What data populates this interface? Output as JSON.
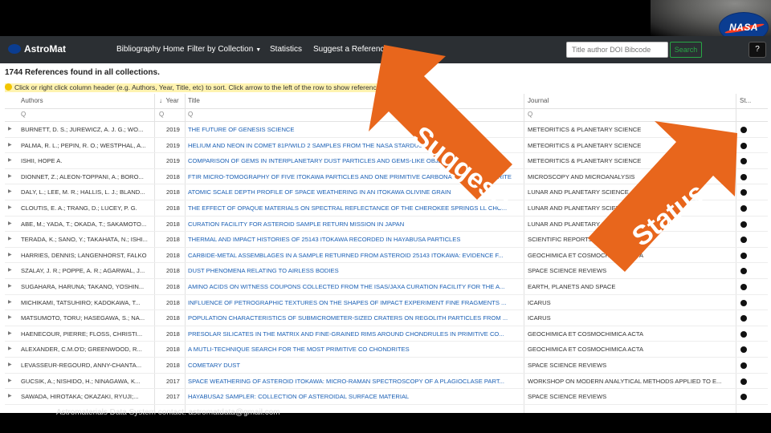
{
  "app": {
    "brand": "AstroMat",
    "nasa_logo_text": "NASA"
  },
  "navbar": {
    "items": [
      "Bibliography Home",
      "Filter by Collection",
      "Statistics",
      "Suggest a Reference"
    ],
    "search_placeholder": "Title author DOI Bibcode",
    "search_button": "Search",
    "help_icon": "?"
  },
  "page": {
    "count_title": "1744 References found in all collections.",
    "hint": "Click or right click column header (e.g. Authors, Year, Title, etc) to sort. Click arrow to the left of the row to show reference details"
  },
  "table": {
    "columns": {
      "authors": "Authors",
      "year": "Year",
      "title": "Title",
      "journal": "Journal",
      "status": "St..."
    },
    "sort_indicator": "↓",
    "filter_placeholder": "Q",
    "rows": [
      {
        "authors": "BURNETT, D. S.; JUREWICZ, A. J. G.; WO...",
        "year": "2019",
        "title": "THE FUTURE OF GENESIS SCIENCE",
        "journal": "METEORITICS & PLANETARY SCIENCE"
      },
      {
        "authors": "PALMA, R. L.; PEPIN, R. O.; WESTPHAL, A...",
        "year": "2019",
        "title": "HELIUM AND NEON IN COMET 81P/WILD 2 SAMPLES FROM THE NASA STARDUST MISSION",
        "journal": "METEORITICS & PLANETARY SCIENCE"
      },
      {
        "authors": "ISHII, HOPE A.",
        "year": "2019",
        "title": "COMPARISON OF GEMS IN INTERPLANETARY DUST PARTICLES AND GEMS-LIKE OBJECTS IN A STARDUST",
        "journal": "METEORITICS & PLANETARY SCIENCE"
      },
      {
        "authors": "DIONNET, Z.; ALEON-TOPPANI, A.; BORO...",
        "year": "2018",
        "title": "FTIR MICRO-TOMOGRAPHY OF FIVE ITOKAWA PARTICLES AND ONE PRIMITIVE CARBONACEOUS CHONDRITE",
        "journal": "MICROSCOPY AND MICROANALYSIS"
      },
      {
        "authors": "DALY, L.; LEE, M. R.; HALLIS, L. J.; BLAND...",
        "year": "2018",
        "title": "ATOMIC SCALE DEPTH PROFILE OF SPACE WEATHERING IN AN ITOKAWA OLIVINE GRAIN",
        "journal": "LUNAR AND PLANETARY SCIENCE"
      },
      {
        "authors": "CLOUTIS, E. A.; TRANG, D.; LUCEY, P. G.",
        "year": "2018",
        "title": "THE EFFECT OF OPAQUE MATERIALS ON SPECTRAL REFLECTANCE OF THE CHEROKEE SPRINGS LL CHO...",
        "journal": "LUNAR AND PLANETARY SCIENCE"
      },
      {
        "authors": "ABE, M.; YADA, T.; OKADA, T.; SAKAMOTO...",
        "year": "2018",
        "title": "CURATION FACILITY FOR ASTEROID SAMPLE RETURN MISSION IN JAPAN",
        "journal": "LUNAR AND PLANETARY SCIENCE"
      },
      {
        "authors": "TERADA, K.; SANO, Y.; TAKAHATA, N.; ISHI...",
        "year": "2018",
        "title": "THERMAL AND IMPACT HISTORIES OF 25143 ITOKAWA RECORDED IN HAYABUSA PARTICLES",
        "journal": "SCIENTIFIC REPORTS"
      },
      {
        "authors": "HARRIES, DENNIS; LANGENHORST, FALKO",
        "year": "2018",
        "title": "CARBIDE-METAL ASSEMBLAGES IN A SAMPLE RETURNED FROM ASTEROID 25143 ITOKAWA: EVIDENCE F...",
        "journal": "GEOCHIMICA ET COSMOCHIMICA ACTA"
      },
      {
        "authors": "SZALAY, J. R.; POPPE, A. R.; AGARWAL, J...",
        "year": "2018",
        "title": "DUST PHENOMENA RELATING TO AIRLESS BODIES",
        "journal": "SPACE SCIENCE REVIEWS"
      },
      {
        "authors": "SUGAHARA, HARUNA; TAKANO, YOSHIN...",
        "year": "2018",
        "title": "AMINO ACIDS ON WITNESS COUPONS COLLECTED FROM THE ISAS/JAXA CURATION FACILITY FOR THE A...",
        "journal": "EARTH, PLANETS AND SPACE"
      },
      {
        "authors": "MICHIKAMI, TATSUHIRO; KADOKAWA, T...",
        "year": "2018",
        "title": "INFLUENCE OF PETROGRAPHIC TEXTURES ON THE SHAPES OF IMPACT EXPERIMENT FINE FRAGMENTS ...",
        "journal": "ICARUS"
      },
      {
        "authors": "MATSUMOTO, TORU; HASEGAWA, S.; NA...",
        "year": "2018",
        "title": "POPULATION CHARACTERISTICS OF SUBMICROMETER-SIZED CRATERS ON REGOLITH PARTICLES FROM ...",
        "journal": "ICARUS"
      },
      {
        "authors": "HAENECOUR, PIERRE; FLOSS, CHRISTI...",
        "year": "2018",
        "title": "PRESOLAR SILICATES IN THE MATRIX AND FINE-GRAINED RIMS AROUND CHONDRULES IN PRIMITIVE CO...",
        "journal": "GEOCHIMICA ET COSMOCHIMICA ACTA"
      },
      {
        "authors": "ALEXANDER, C.M.O'D; GREENWOOD, R...",
        "year": "2018",
        "title": "A MUTLI-TECHNIQUE SEARCH FOR THE MOST PRIMITIVE CO CHONDRITES",
        "journal": "GEOCHIMICA ET COSMOCHIMICA ACTA"
      },
      {
        "authors": "LEVASSEUR-REGOURD, ANNY-CHANTA...",
        "year": "2018",
        "title": "COMETARY DUST",
        "journal": "SPACE SCIENCE REVIEWS"
      },
      {
        "authors": "GUCSIK, A.; NISHIDO, H.; NINAGAWA, K...",
        "year": "2017",
        "title": "SPACE WEATHERING OF ASTEROID ITOKAWA: MICRO-RAMAN SPECTROSCOPY OF A PLAGIOCLASE PART...",
        "journal": "WORKSHOP ON MODERN ANALYTICAL METHODS APPLIED TO E..."
      },
      {
        "authors": "SAWADA, HIROTAKA; OKAZAKI, RYUJI;...",
        "year": "2017",
        "title": "HAYABUSA2 SAMPLER: COLLECTION OF ASTEROIDAL SURFACE MATERIAL",
        "journal": "SPACE SCIENCE REVIEWS"
      }
    ]
  },
  "annotations": {
    "suggest": "Suggest!",
    "status": "Status",
    "arrow_color": "#e8661c"
  },
  "footer": {
    "text": "Astromaterials Data System contact: astromatdata@gmail.com"
  }
}
